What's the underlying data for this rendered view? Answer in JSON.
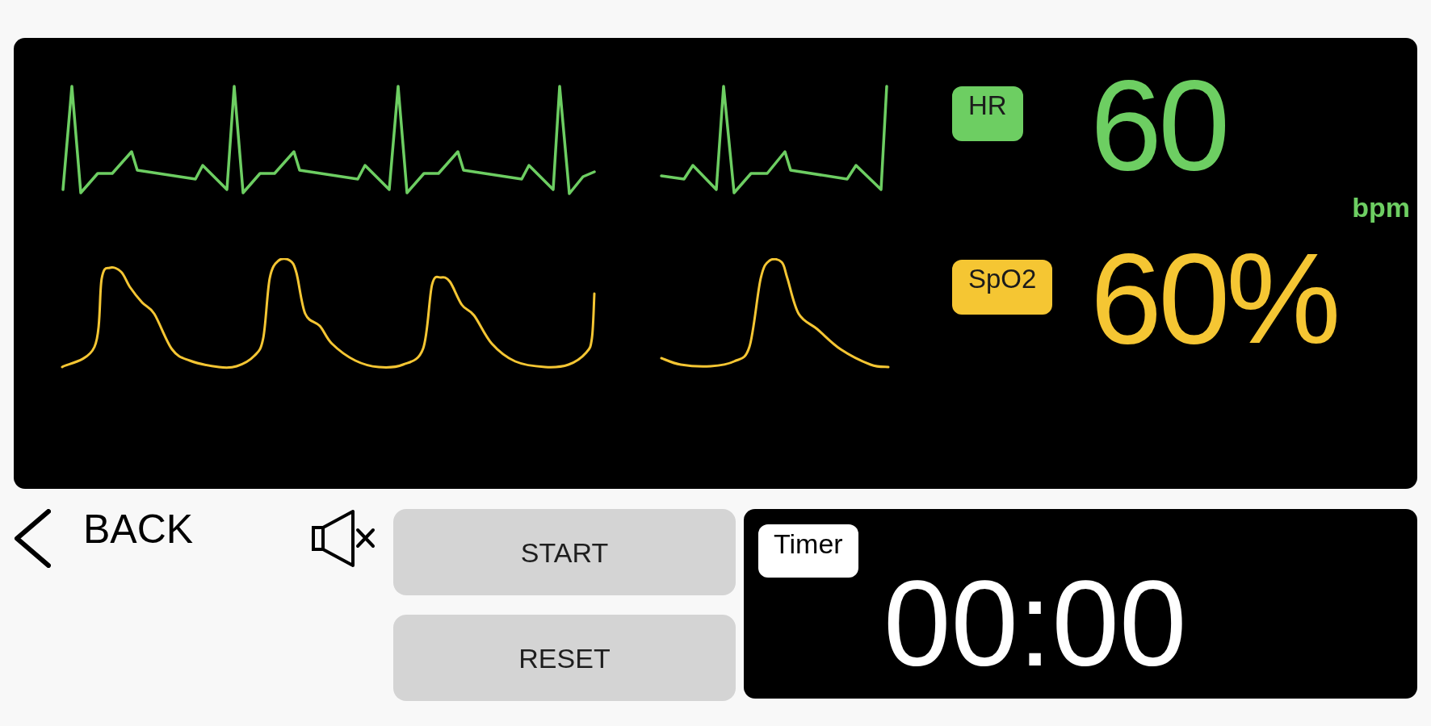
{
  "monitor": {
    "channels": [
      {
        "kind": "ecg",
        "label": "HR",
        "value": "60",
        "unit": "bpm",
        "color": "#6dce62"
      },
      {
        "kind": "pleth",
        "label": "SpO2",
        "value": "60%",
        "color": "#f5c633"
      }
    ]
  },
  "back": {
    "label": "BACK"
  },
  "sound": {
    "muted": true
  },
  "buttons": [
    "START",
    "RESET"
  ],
  "timer": {
    "label": "Timer",
    "value": "00:00"
  }
}
